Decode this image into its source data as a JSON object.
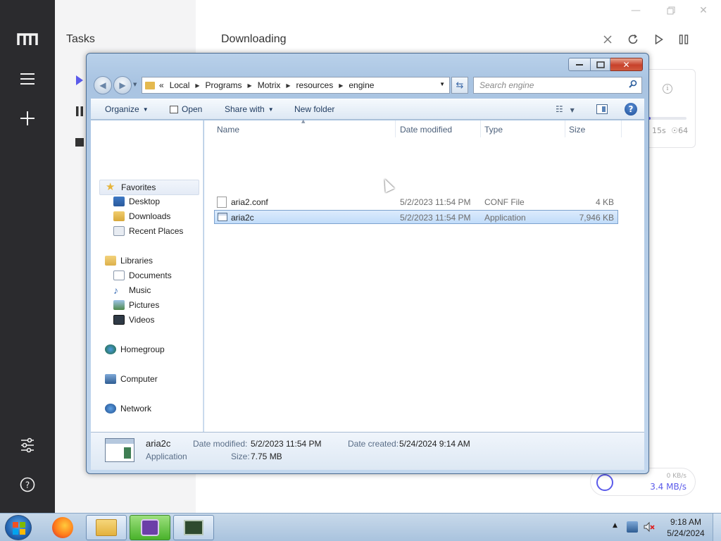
{
  "motrix": {
    "tasks_title": "Tasks",
    "downloading_title": "Downloading",
    "task_card": {
      "progress": 0.09,
      "time_left": "15s",
      "connections": "☉64"
    },
    "speed": {
      "upload": "0 KB/s",
      "download": "3.4 MB/s"
    }
  },
  "explorer": {
    "address": {
      "overflow": "«",
      "crumbs": [
        "Local",
        "Programs",
        "Motrix",
        "resources",
        "engine"
      ]
    },
    "search_placeholder": "Search engine",
    "toolbar": {
      "organize": "Organize",
      "open": "Open",
      "share_with": "Share with",
      "new_folder": "New folder"
    },
    "nav": {
      "favorites": "Favorites",
      "desktop": "Desktop",
      "downloads": "Downloads",
      "recent_places": "Recent Places",
      "libraries": "Libraries",
      "documents": "Documents",
      "music": "Music",
      "pictures": "Pictures",
      "videos": "Videos",
      "homegroup": "Homegroup",
      "computer": "Computer",
      "network": "Network"
    },
    "columns": {
      "name": "Name",
      "date_modified": "Date modified",
      "type": "Type",
      "size": "Size"
    },
    "files": [
      {
        "name": "aria2.conf",
        "date": "5/2/2023 11:54 PM",
        "type": "CONF File",
        "size": "4 KB"
      },
      {
        "name": "aria2c",
        "date": "5/2/2023 11:54 PM",
        "type": "Application",
        "size": "7,946 KB"
      }
    ],
    "details": {
      "name": "aria2c",
      "type": "Application",
      "date_modified_label": "Date modified:",
      "date_modified": "5/2/2023 11:54 PM",
      "size_label": "Size:",
      "size": "7.75 MB",
      "date_created_label": "Date created:",
      "date_created": "5/24/2024 9:14 AM"
    }
  },
  "taskbar": {
    "time": "9:18 AM",
    "date": "5/24/2024"
  },
  "colors": {
    "accent": "#5b5bea",
    "sidebar": "#2b2b2e"
  }
}
